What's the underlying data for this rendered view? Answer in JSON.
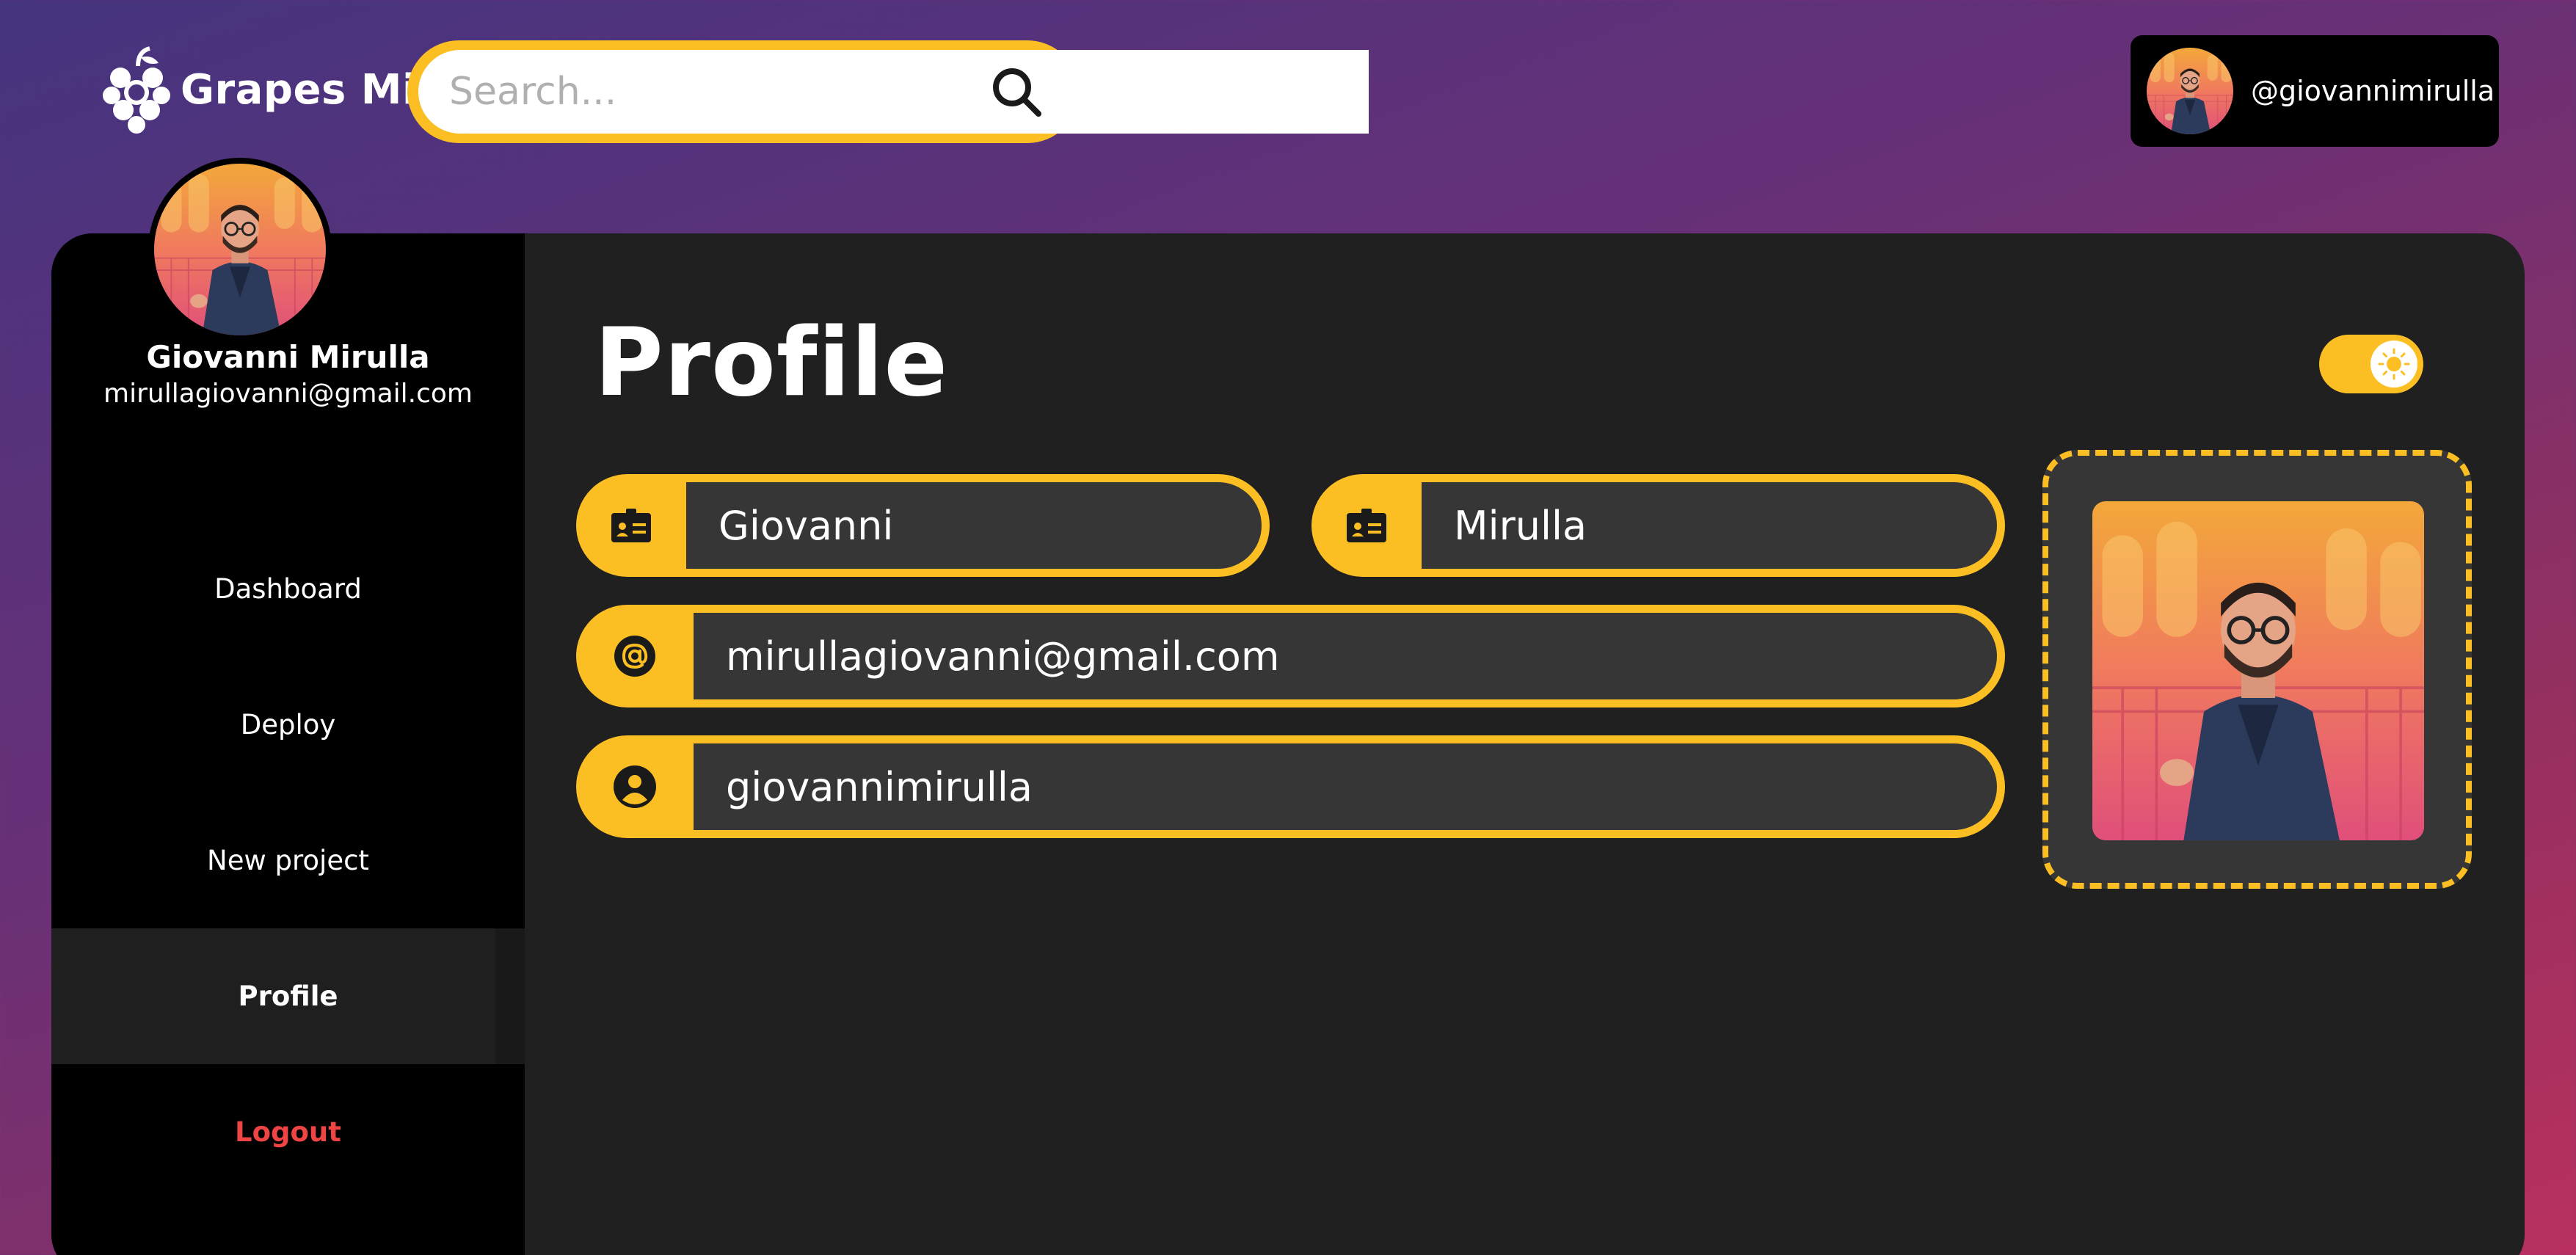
{
  "header": {
    "app_name": "Grapes Mi",
    "search": {
      "placeholder": "Search...",
      "value": ""
    },
    "user_handle": "@giovannimirulla"
  },
  "sidebar": {
    "user_name": "Giovanni Mirulla",
    "user_email": "mirullagiovanni@gmail.com",
    "items": [
      {
        "label": "Dashboard",
        "active": false
      },
      {
        "label": "Deploy",
        "active": false
      },
      {
        "label": "New project",
        "active": false
      },
      {
        "label": "Profile",
        "active": true
      },
      {
        "label": "Logout",
        "active": false
      }
    ]
  },
  "main": {
    "title": "Profile",
    "theme_toggle": {
      "state": "light"
    },
    "fields": {
      "first_name": {
        "value": "Giovanni",
        "icon": "id-card-icon"
      },
      "last_name": {
        "value": "Mirulla",
        "icon": "id-card-icon"
      },
      "email": {
        "value": "mirullagiovanni@gmail.com",
        "icon": "at-icon"
      },
      "username": {
        "value": "giovannimirulla",
        "icon": "user-circle-icon"
      }
    }
  },
  "colors": {
    "accent": "#fbbf24",
    "panel": "#202020",
    "sidebar": "#000000",
    "field": "#363636",
    "logout": "#ef4444"
  }
}
